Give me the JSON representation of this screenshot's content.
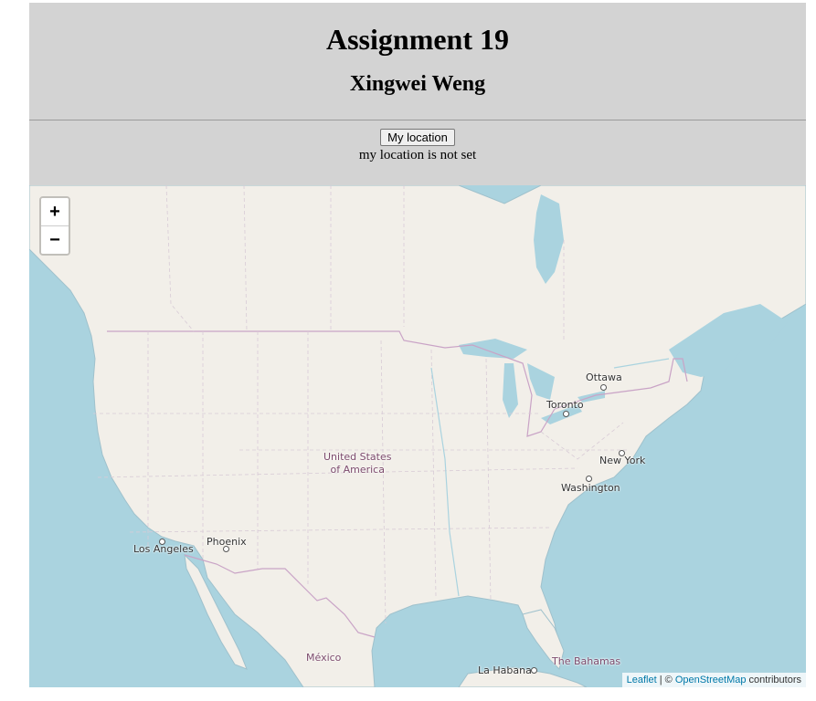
{
  "header": {
    "title": "Assignment 19",
    "subtitle": "Xingwei Weng"
  },
  "controls": {
    "button_label": "My location",
    "status_text": "my location is not set"
  },
  "map": {
    "zoom_in": "+",
    "zoom_out": "−",
    "labels": {
      "ottawa": "Ottawa",
      "toronto": "Toronto",
      "new_york": "New York",
      "washington": "Washington",
      "usa_line1": "United States",
      "usa_line2": "of America",
      "los_angeles": "Los Angeles",
      "phoenix": "Phoenix",
      "mexico": "México",
      "la_habana": "La Habana",
      "bahamas": "The Bahamas"
    },
    "colors": {
      "water": "#aad3df",
      "land": "#f2efe9",
      "border": "#c9a3c6"
    }
  },
  "attribution": {
    "leaflet": "Leaflet",
    "separator": " | © ",
    "osm": "OpenStreetMap",
    "suffix": " contributors"
  }
}
